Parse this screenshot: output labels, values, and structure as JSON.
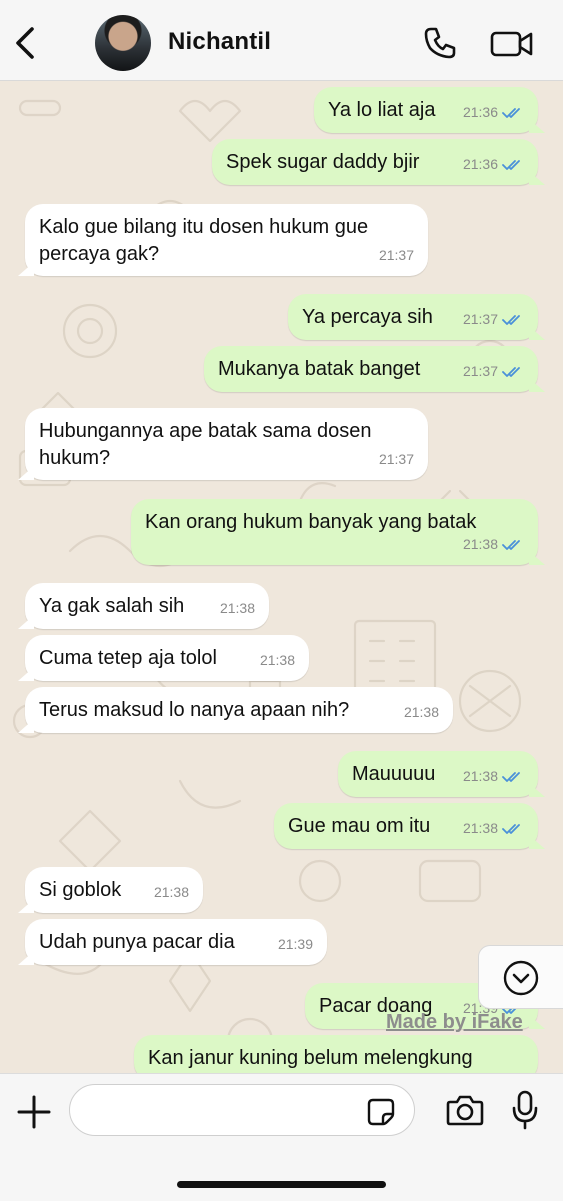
{
  "header": {
    "contact_name": "Nichantil",
    "back_icon": "chevron-left-icon",
    "call_icon": "phone-icon",
    "video_icon": "video-camera-icon"
  },
  "colors": {
    "outgoing_bubble": "#dcf8c6",
    "incoming_bubble": "#ffffff",
    "read_ticks": "#4a90d9",
    "wallpaper": "#efe7dc"
  },
  "messages": [
    {
      "dir": "out",
      "text": "Ya lo liat aja",
      "time": "21:36",
      "read": true
    },
    {
      "dir": "out",
      "text": "Spek sugar daddy bjir",
      "time": "21:36",
      "read": true
    },
    {
      "dir": "in",
      "lines": [
        "Kalo gue bilang itu dosen hukum gue",
        "percaya gak?"
      ],
      "time": "21:37"
    },
    {
      "dir": "out",
      "text": "Ya percaya sih",
      "time": "21:37",
      "read": true
    },
    {
      "dir": "out",
      "text": "Mukanya batak banget",
      "time": "21:37",
      "read": true
    },
    {
      "dir": "in",
      "lines": [
        "Hubungannya ape batak sama dosen",
        "hukum?"
      ],
      "time": "21:37"
    },
    {
      "dir": "out",
      "text": "Kan orang hukum banyak yang batak",
      "time": "21:38",
      "read": true
    },
    {
      "dir": "in",
      "text": "Ya gak salah sih",
      "time": "21:38"
    },
    {
      "dir": "in",
      "text": "Cuma tetep aja tolol",
      "time": "21:38"
    },
    {
      "dir": "in",
      "text": "Terus maksud lo nanya apaan nih?",
      "time": "21:38"
    },
    {
      "dir": "out",
      "text": "Mauuuuu",
      "time": "21:38",
      "read": true
    },
    {
      "dir": "out",
      "text": "Gue mau om itu",
      "time": "21:38",
      "read": true
    },
    {
      "dir": "in",
      "text": "Si goblok",
      "time": "21:38"
    },
    {
      "dir": "in",
      "text": "Udah punya pacar dia",
      "time": "21:39"
    },
    {
      "dir": "out",
      "text": "Pacar doang",
      "time": "21:39",
      "read": true
    },
    {
      "dir": "out",
      "text": "Kan janur kuning belum melengkung",
      "time": "",
      "read": false
    }
  ],
  "scroll_down_icon": "chevron-down-circle-icon",
  "watermark": "Made by iFake",
  "composer": {
    "placeholder": "",
    "plus_icon": "plus-icon",
    "sticker_icon": "sticker-icon",
    "camera_icon": "camera-icon",
    "mic_icon": "microphone-icon"
  }
}
